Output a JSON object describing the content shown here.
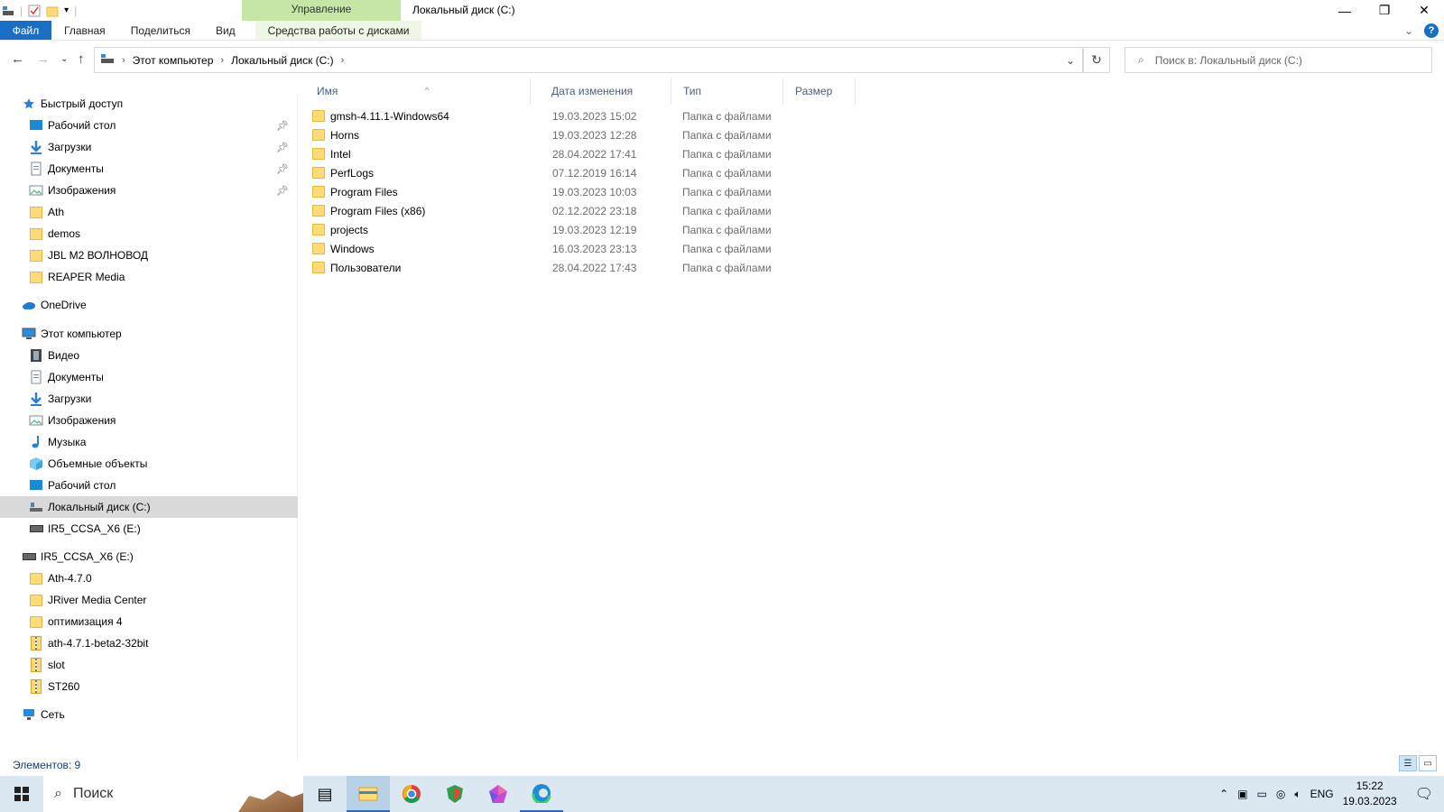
{
  "title": {
    "window": "Локальный диск (C:)",
    "context_tab_header": "Управление"
  },
  "ribbon": {
    "tabs": [
      {
        "label": "Файл"
      },
      {
        "label": "Главная"
      },
      {
        "label": "Поделиться"
      },
      {
        "label": "Вид"
      },
      {
        "label": "Средства работы с дисками"
      }
    ],
    "help": "?"
  },
  "addressbar": {
    "crumbs": [
      "Этот компьютер",
      "Локальный диск (C:)"
    ]
  },
  "search": {
    "placeholder": "Поиск в: Локальный диск (C:)"
  },
  "sidebar": {
    "items": [
      {
        "label": "Быстрый доступ",
        "icon": "star-icon",
        "level": 0
      },
      {
        "label": "Рабочий стол",
        "icon": "desktop-icon",
        "level": 1,
        "pinned": true
      },
      {
        "label": "Загрузки",
        "icon": "download-icon",
        "level": 1,
        "pinned": true
      },
      {
        "label": "Документы",
        "icon": "documents-icon",
        "level": 1,
        "pinned": true
      },
      {
        "label": "Изображения",
        "icon": "pictures-icon",
        "level": 1,
        "pinned": true
      },
      {
        "label": "Ath",
        "icon": "folder-icon",
        "level": 1
      },
      {
        "label": "demos",
        "icon": "folder-icon",
        "level": 1
      },
      {
        "label": "JBL M2 ВОЛНОВОД",
        "icon": "folder-icon",
        "level": 1
      },
      {
        "label": "REAPER Media",
        "icon": "folder-icon",
        "level": 1
      },
      {
        "label": "OneDrive",
        "icon": "cloud-icon",
        "level": 0
      },
      {
        "label": "Этот компьютер",
        "icon": "computer-icon",
        "level": 0
      },
      {
        "label": "Видео",
        "icon": "video-icon",
        "level": 1
      },
      {
        "label": "Документы",
        "icon": "documents-icon",
        "level": 1
      },
      {
        "label": "Загрузки",
        "icon": "download-icon",
        "level": 1
      },
      {
        "label": "Изображения",
        "icon": "pictures-icon",
        "level": 1
      },
      {
        "label": "Музыка",
        "icon": "music-icon",
        "level": 1
      },
      {
        "label": "Объемные объекты",
        "icon": "3d-objects-icon",
        "level": 1
      },
      {
        "label": "Рабочий стол",
        "icon": "desktop-icon",
        "level": 1
      },
      {
        "label": "Локальный диск (C:)",
        "icon": "local-disk-icon",
        "level": 1,
        "selected": true
      },
      {
        "label": "IR5_CCSA_X6 (E:)",
        "icon": "drive-icon",
        "level": 1
      },
      {
        "label": "IR5_CCSA_X6 (E:)",
        "icon": "drive-icon",
        "level": 0
      },
      {
        "label": "Ath-4.7.0",
        "icon": "folder-icon",
        "level": 1
      },
      {
        "label": "JRiver Media Center",
        "icon": "folder-icon",
        "level": 1
      },
      {
        "label": "оптимизация 4",
        "icon": "folder-icon",
        "level": 1
      },
      {
        "label": "ath-4.7.1-beta2-32bit",
        "icon": "zip-folder-icon",
        "level": 1
      },
      {
        "label": "slot",
        "icon": "zip-folder-icon",
        "level": 1
      },
      {
        "label": "ST260",
        "icon": "zip-folder-icon",
        "level": 1
      },
      {
        "label": "Сеть",
        "icon": "network-icon",
        "level": 0
      }
    ]
  },
  "columns": {
    "name": "Имя",
    "date": "Дата изменения",
    "type": "Тип",
    "size": "Размер"
  },
  "files": [
    {
      "name": "gmsh-4.11.1-Windows64",
      "date": "19.03.2023 15:02",
      "type": "Папка с файлами"
    },
    {
      "name": "Horns",
      "date": "19.03.2023 12:28",
      "type": "Папка с файлами"
    },
    {
      "name": "Intel",
      "date": "28.04.2022 17:41",
      "type": "Папка с файлами"
    },
    {
      "name": "PerfLogs",
      "date": "07.12.2019 16:14",
      "type": "Папка с файлами"
    },
    {
      "name": "Program Files",
      "date": "19.03.2023 10:03",
      "type": "Папка с файлами"
    },
    {
      "name": "Program Files (x86)",
      "date": "02.12.2022 23:18",
      "type": "Папка с файлами"
    },
    {
      "name": "projects",
      "date": "19.03.2023 12:19",
      "type": "Папка с файлами"
    },
    {
      "name": "Windows",
      "date": "16.03.2023 23:13",
      "type": "Папка с файлами"
    },
    {
      "name": "Пользователи",
      "date": "28.04.2022 17:43",
      "type": "Папка с файлами"
    }
  ],
  "status": {
    "items_count": "Элементов: 9"
  },
  "taskbar": {
    "search": "Поиск",
    "lang": "ENG",
    "time": "15:22",
    "date": "19.03.2023"
  },
  "colors": {
    "accent": "#1a6fc4",
    "context_tab": "#c5e6a6",
    "folder": "#fedb74",
    "taskbar": "#dbe7f1"
  }
}
